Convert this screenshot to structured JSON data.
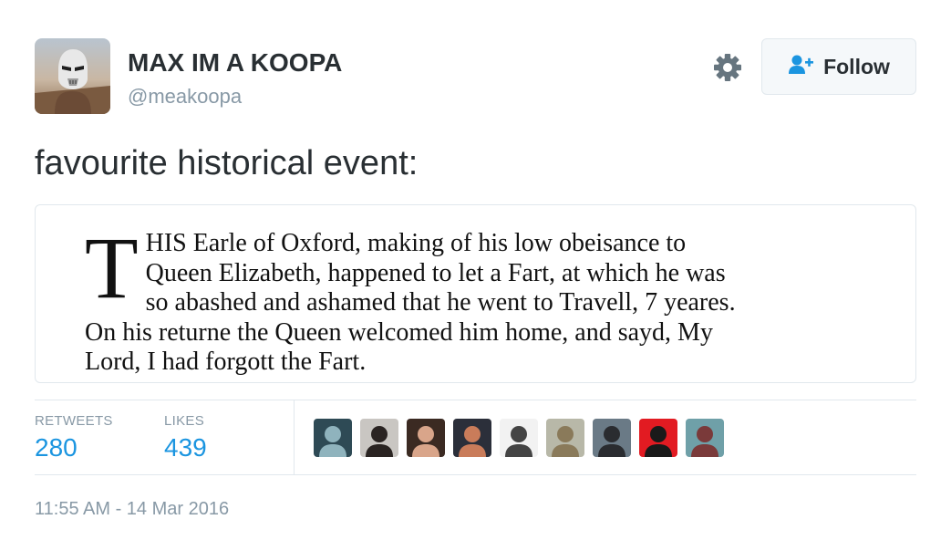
{
  "user": {
    "display_name": "MAX IM A KOOPA",
    "handle": "@meakoopa",
    "avatar_icon": "stormtrooper-helmet-avatar"
  },
  "actions": {
    "settings_icon": "gear-icon",
    "follow_icon": "add-user-icon",
    "follow_label": "Follow"
  },
  "tweet": {
    "text": "favourite historical event:"
  },
  "media": {
    "dropcap": "T",
    "lines": [
      "HIS Earle of Oxford, making of his low obeisance to",
      "Queen Elizabeth, happened to let a Fart, at which he was",
      "so abashed and ashamed that he went to Travell, 7 yeares.",
      "On his returne the Queen welcomed him home, and sayd, My",
      "Lord, I had forgott the Fart."
    ]
  },
  "stats": {
    "retweets_label": "RETWEETS",
    "retweets_count": "280",
    "likes_label": "LIKES",
    "likes_count": "439"
  },
  "likers": [
    {
      "name": "liker-avatar-1",
      "bg": "#2e4a55",
      "fg": "#8fb3bd"
    },
    {
      "name": "liker-avatar-2",
      "bg": "#c9c6c2",
      "fg": "#2a2422"
    },
    {
      "name": "liker-avatar-3",
      "bg": "#3b2a22",
      "fg": "#d9a58a"
    },
    {
      "name": "liker-avatar-4",
      "bg": "#2b2f3a",
      "fg": "#c97c5a"
    },
    {
      "name": "liker-avatar-5",
      "bg": "#f2f2f2",
      "fg": "#444444"
    },
    {
      "name": "liker-avatar-6",
      "bg": "#b8b8a8",
      "fg": "#8a7a5a"
    },
    {
      "name": "liker-avatar-7",
      "bg": "#6a7a86",
      "fg": "#2a2c30"
    },
    {
      "name": "liker-avatar-8",
      "bg": "#e21b22",
      "fg": "#1a1a1a"
    },
    {
      "name": "liker-avatar-9",
      "bg": "#6fa0a8",
      "fg": "#7a3a3a"
    }
  ],
  "timestamp": "11:55 AM - 14 Mar 2016"
}
